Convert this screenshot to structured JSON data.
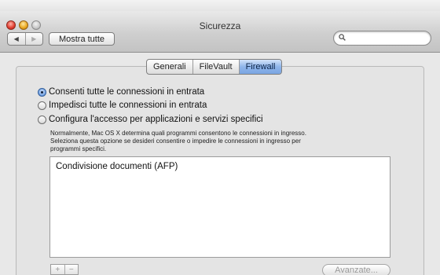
{
  "window": {
    "title": "Sicurezza"
  },
  "toolbar": {
    "back_glyph": "◀",
    "forward_glyph": "▶",
    "show_all_label": "Mostra tutte",
    "search": {
      "value": "",
      "placeholder": ""
    }
  },
  "tabs": [
    {
      "label": "Generali",
      "active": false
    },
    {
      "label": "FileVault",
      "active": false
    },
    {
      "label": "Firewall",
      "active": true
    }
  ],
  "firewall": {
    "options": [
      {
        "label": "Consenti tutte le connessioni in entrata",
        "selected": true
      },
      {
        "label": "Impedisci tutte le connessioni in entrata",
        "selected": false
      },
      {
        "label": "Configura l'accesso per applicazioni e servizi specifici",
        "selected": false
      }
    ],
    "description_line1": "Normalmente, Mac OS X determina quali programmi consentono le connessioni in ingresso.",
    "description_line2": "Seleziona questa opzione se desideri consentire o impedire le connessioni in ingresso per",
    "description_line3": "programmi specifici.",
    "list_items": [
      "Condivisione documenti (AFP)"
    ],
    "add_label": "+",
    "remove_label": "−",
    "advanced_label": "Avanzate..."
  },
  "colors": {
    "selected_tab": "#7aa5e2",
    "content_bg": "#e8e8e8"
  },
  "icons": {
    "search": "magnifier-icon"
  }
}
